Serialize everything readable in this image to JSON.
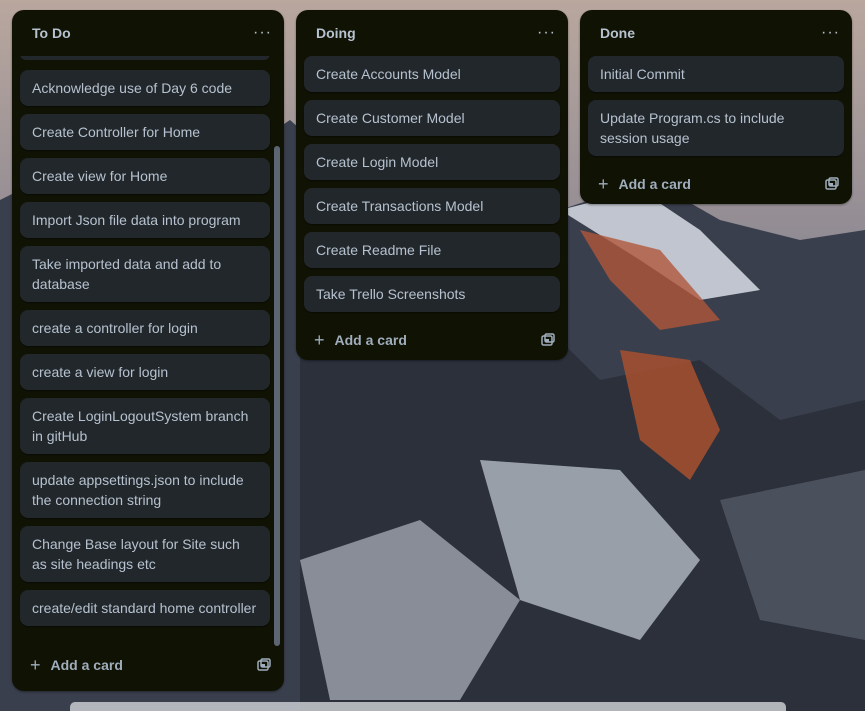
{
  "lists": [
    {
      "title": "To Do",
      "menu": "···",
      "cards": [
        "Acknowledge use of Day 6 code",
        "Create Controller for Home",
        "Create view for Home",
        "Import Json file data into program",
        "Take imported data and add to database",
        "create a controller for login",
        "create a view for login",
        "Create LoginLogoutSystem branch in gitHub",
        "update appsettings.json to include the connection string",
        "Change Base layout for Site such as site headings etc",
        "create/edit standard home controller"
      ],
      "add_label": "Add a card"
    },
    {
      "title": "Doing",
      "menu": "···",
      "cards": [
        "Create Accounts Model",
        "Create Customer Model",
        "Create Login Model",
        "Create Transactions Model",
        "Create Readme File",
        "Take Trello Screenshots"
      ],
      "add_label": "Add a card"
    },
    {
      "title": "Done",
      "menu": "···",
      "cards": [
        "Initial Commit",
        "Update Program.cs to include session usage"
      ],
      "add_label": "Add a card"
    }
  ],
  "icons": {
    "add": "plus-icon",
    "template": "card-template-icon",
    "menu": "more-options-icon"
  }
}
